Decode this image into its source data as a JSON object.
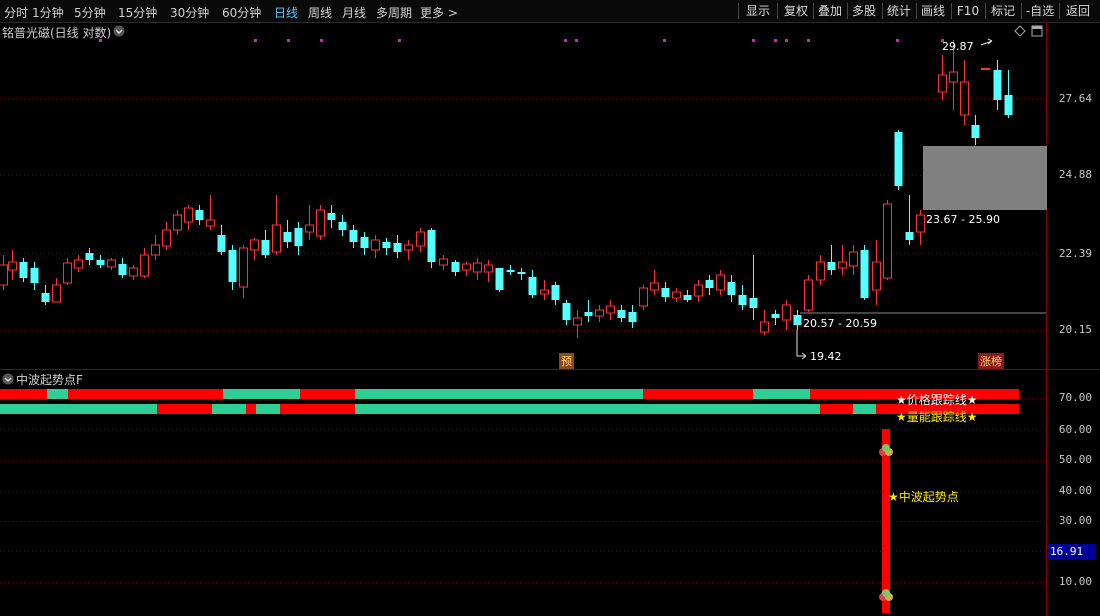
{
  "toolbar": {
    "tabs": [
      "分时",
      "1分钟",
      "5分钟",
      "15分钟",
      "30分钟",
      "60分钟",
      "日线",
      "周线",
      "月线",
      "多周期",
      "更多 >"
    ],
    "active_tab": "日线",
    "right_buttons": [
      "显示",
      "复权",
      "叠加",
      "多股",
      "统计",
      "画线",
      "F10",
      "标记",
      "-自选",
      "返回"
    ]
  },
  "chart_title": "铭普光磁(日线 对数)",
  "price_axis": {
    "labels": [
      "29.87",
      "27.64",
      "24.88",
      "22.39",
      "20.15"
    ]
  },
  "price_annotations": {
    "high_label": "29.87",
    "low_label": "19.42",
    "range_upper": "23.67 - 25.90",
    "range_lower": "20.57 - 20.59"
  },
  "event_markers": {
    "forecast": "预",
    "top_list": "涨榜"
  },
  "indicator": {
    "name": "中波起势点F",
    "axis_labels": [
      "70.00",
      "60.00",
      "50.00",
      "40.00",
      "30.00",
      "10.00"
    ],
    "current_value": "16.91",
    "price_track_label": "★价格跟踪线★",
    "volume_track_label": "★量能跟踪线★",
    "signal_label": "★中波起势点"
  },
  "colors": {
    "up": "#ff3232",
    "down": "#54ffff",
    "band_red": "#ff0000",
    "band_green": "#2ecf96",
    "accent_blue": "#5ec8ff",
    "value_badge": "#000099",
    "grey_box": "#808080"
  }
}
